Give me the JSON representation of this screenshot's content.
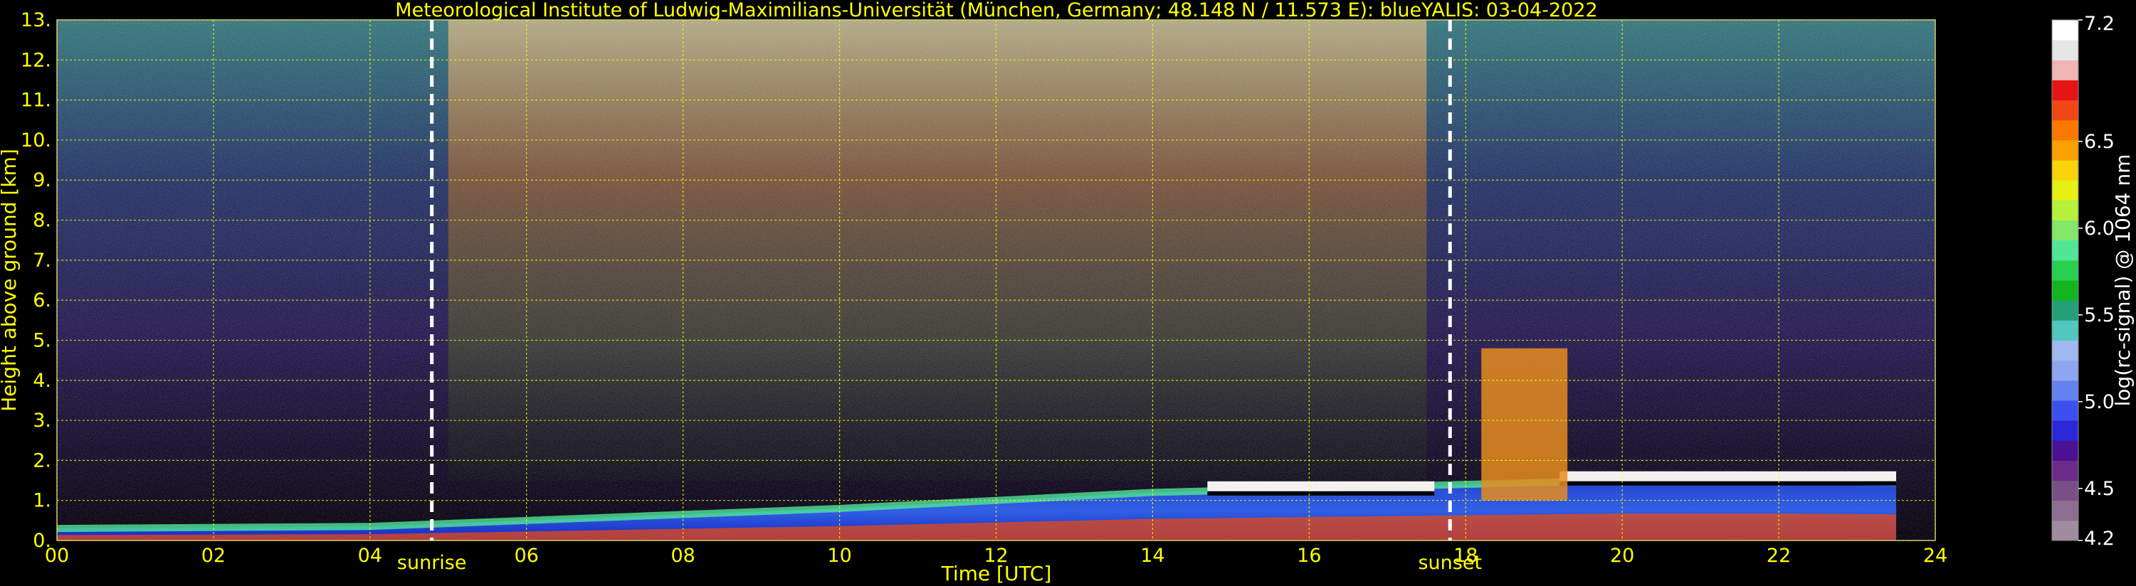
{
  "chart_data": {
    "type": "heatmap",
    "title": "Meteorological Institute of Ludwig-Maximilians-Universität (München, Germany; 48.148 N / 11.573 E):     blueYALIS: 03-04-2022",
    "xlabel": "Time [UTC]",
    "ylabel": "Height above ground [km]",
    "colorbar_label": "log(rc-signal) @ 1064 nm",
    "xlim": [
      0,
      24
    ],
    "ylim": [
      0,
      13
    ],
    "x_ticks": [
      0,
      2,
      4,
      6,
      8,
      10,
      12,
      14,
      16,
      18,
      20,
      22,
      24
    ],
    "x_tick_labels": [
      "00",
      "02",
      "04",
      "06",
      "08",
      "10",
      "12",
      "14",
      "16",
      "18",
      "20",
      "22",
      "24"
    ],
    "y_ticks": [
      0,
      1,
      2,
      3,
      4,
      5,
      6,
      7,
      8,
      9,
      10,
      11,
      12,
      13
    ],
    "y_tick_labels": [
      "0.",
      "1.",
      "2.",
      "3.",
      "4.",
      "5.",
      "6.",
      "7.",
      "8.",
      "9.",
      "10.",
      "11.",
      "12.",
      "13."
    ],
    "grid": true,
    "colorbar_range": [
      4.2,
      7.2
    ],
    "colorbar_ticks": [
      4.2,
      4.5,
      5.0,
      5.5,
      6.0,
      6.5,
      7.2
    ],
    "colorbar_tick_labels": [
      "4.2",
      "4.5",
      "5.0",
      "5.5",
      "6.0",
      "6.5",
      "7.2"
    ],
    "colormap": [
      "#a08ca0",
      "#8e6e90",
      "#7a4f86",
      "#6a2c88",
      "#4b1296",
      "#2828d8",
      "#3c50f0",
      "#6482f0",
      "#8ca6f0",
      "#a0b8f0",
      "#50c8c0",
      "#23a078",
      "#14b41e",
      "#28d050",
      "#50e696",
      "#82e668",
      "#b4f03c",
      "#e6f014",
      "#fad20a",
      "#faa000",
      "#fa7800",
      "#f04614",
      "#e61414",
      "#f0b4b4",
      "#e6e6e6",
      "#ffffff"
    ],
    "annotations": [
      {
        "label": "sunrise",
        "x": 4.79
      },
      {
        "label": "sunset",
        "x": 17.8
      }
    ],
    "features": {
      "boundary_layer_top_km": [
        [
          0,
          0.3
        ],
        [
          4,
          0.35
        ],
        [
          6,
          0.5
        ],
        [
          8,
          0.65
        ],
        [
          10,
          0.8
        ],
        [
          12,
          1.0
        ],
        [
          14,
          1.2
        ],
        [
          16,
          1.3
        ],
        [
          18,
          1.4
        ],
        [
          20,
          1.5
        ],
        [
          22,
          1.5
        ],
        [
          23.5,
          1.45
        ]
      ],
      "cloud_segments": [
        {
          "x_start": 14.7,
          "x_end": 17.6,
          "height_km": 1.3
        },
        {
          "x_start": 19.2,
          "x_end": 23.5,
          "height_km": 1.55
        }
      ],
      "daytime_noise_band": [
        5.0,
        17.5
      ],
      "cirrus_plume": {
        "x_start": 18.2,
        "x_end": 19.3,
        "height_range_km": [
          1.0,
          4.8
        ]
      }
    }
  },
  "colors": {
    "text": "#ffff00",
    "background": "#000000",
    "grid": "#ffff00",
    "annotation_line": "#ffffff"
  }
}
